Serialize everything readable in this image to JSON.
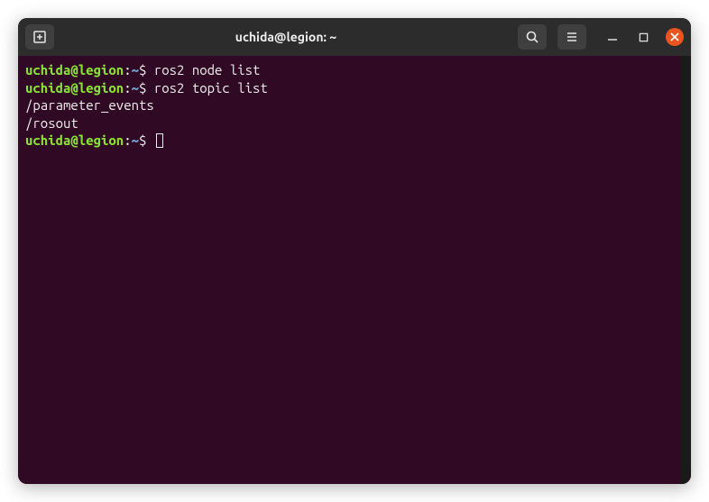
{
  "window": {
    "title": "uchida@legion: ~"
  },
  "prompt": {
    "user_host": "uchida@legion",
    "colon": ":",
    "path": "~",
    "dollar": "$"
  },
  "lines": {
    "cmd1": " ros2 node list",
    "cmd2": " ros2 topic list",
    "out1": "/parameter_events",
    "out2": "/rosout",
    "cmd3": " "
  }
}
